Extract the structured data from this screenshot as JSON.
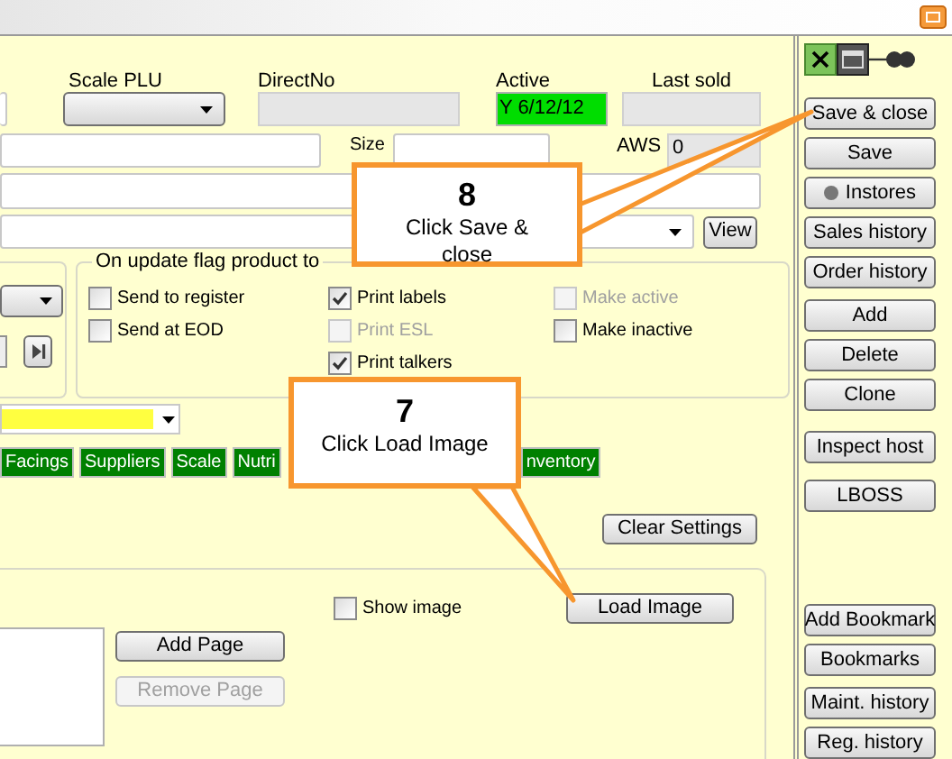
{
  "top_row": {
    "scale_plu_label": "Scale PLU",
    "direct_no_label": "DirectNo",
    "active_label": "Active",
    "active_value": "Y 6/12/12",
    "last_sold_label": "Last sold"
  },
  "size_label": "Size",
  "aws_label": "AWS",
  "aws_value": "0",
  "view_button": "View",
  "flag_group": {
    "title": "On update flag product to",
    "columns": [
      [
        {
          "label": "Send to register",
          "checked": false,
          "disabled": false
        },
        {
          "label": "Send at EOD",
          "checked": false,
          "disabled": false
        }
      ],
      [
        {
          "label": "Print labels",
          "checked": true,
          "disabled": false
        },
        {
          "label": "Print ESL",
          "checked": false,
          "disabled": true
        },
        {
          "label": "Print talkers",
          "checked": true,
          "disabled": false
        }
      ],
      [
        {
          "label": "Make active",
          "checked": false,
          "disabled": true
        },
        {
          "label": "Make inactive",
          "checked": false,
          "disabled": false
        }
      ]
    ]
  },
  "tabs": [
    {
      "label": "Facings"
    },
    {
      "label": "Suppliers"
    },
    {
      "label": "Scale"
    },
    {
      "label": "Nutri"
    },
    {
      "label": "nventory"
    }
  ],
  "clear_settings_button": "Clear Settings",
  "image_group": {
    "show_image": {
      "label": "Show image",
      "checked": false
    },
    "load_image_button": "Load Image",
    "add_page": {
      "label": "Add Page",
      "disabled": false
    },
    "remove_page": {
      "label": "Remove Page",
      "disabled": true
    }
  },
  "side_groups": [
    [
      {
        "label": "Save & close",
        "kind": "plain"
      },
      {
        "label": "Save",
        "kind": "plain"
      },
      {
        "label": "Instores",
        "kind": "dot"
      },
      {
        "label": "Sales history",
        "kind": "plain"
      },
      {
        "label": "Order history",
        "kind": "plain"
      }
    ],
    [
      {
        "label": "Add",
        "kind": "plain"
      },
      {
        "label": "Delete",
        "kind": "plain"
      },
      {
        "label": "Clone",
        "kind": "plain"
      }
    ],
    [
      {
        "label": "Inspect host",
        "kind": "plain"
      }
    ],
    [
      {
        "label": "LBOSS",
        "kind": "plain"
      }
    ],
    [
      {
        "label": "Add Bookmark",
        "kind": "plain"
      },
      {
        "label": "Bookmarks",
        "kind": "plain"
      }
    ],
    [
      {
        "label": "Maint. history",
        "kind": "plain"
      },
      {
        "label": "Reg. history",
        "kind": "plain"
      }
    ]
  ],
  "callouts": [
    {
      "number": "8",
      "text": "Click Save & close"
    },
    {
      "number": "7",
      "text": "Click Load Image"
    }
  ]
}
